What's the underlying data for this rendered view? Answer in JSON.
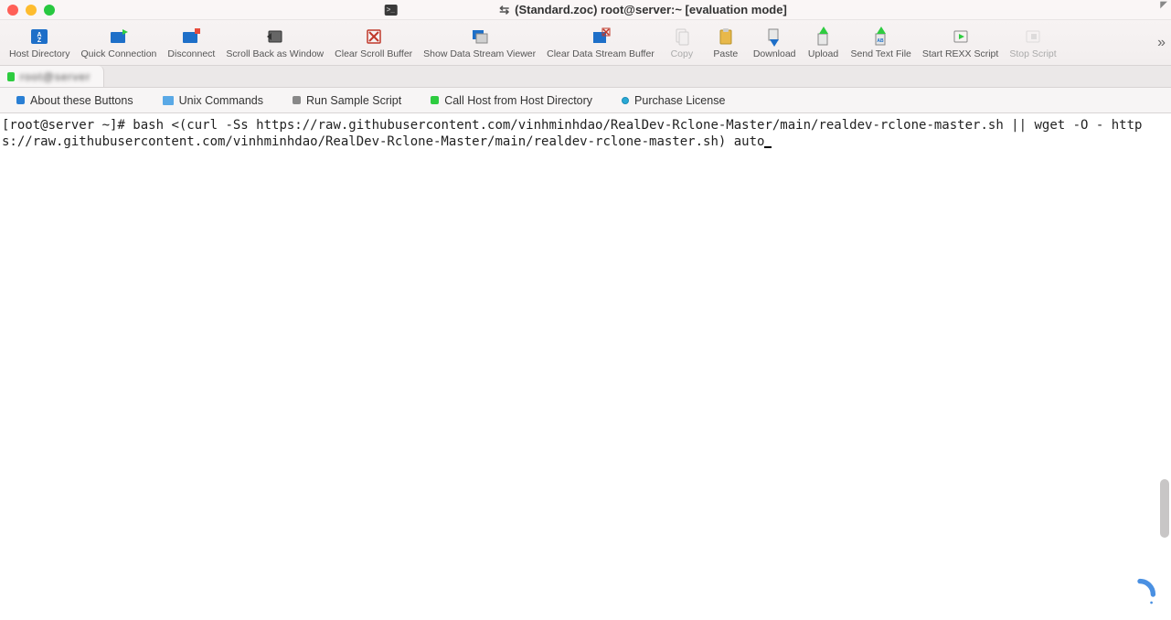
{
  "window": {
    "title": "(Standard.zoc) root@server:~ [evaluation mode]"
  },
  "toolbar": [
    {
      "id": "host-directory",
      "label": "Host Directory",
      "enabled": true
    },
    {
      "id": "quick-connection",
      "label": "Quick Connection",
      "enabled": true
    },
    {
      "id": "disconnect",
      "label": "Disconnect",
      "enabled": true
    },
    {
      "id": "scroll-back-window",
      "label": "Scroll Back as Window",
      "enabled": true
    },
    {
      "id": "clear-scroll-buffer",
      "label": "Clear Scroll Buffer",
      "enabled": true
    },
    {
      "id": "show-data-stream",
      "label": "Show Data Stream Viewer",
      "enabled": true
    },
    {
      "id": "clear-data-stream",
      "label": "Clear Data Stream Buffer",
      "enabled": true
    },
    {
      "id": "copy",
      "label": "Copy",
      "enabled": false
    },
    {
      "id": "paste",
      "label": "Paste",
      "enabled": true
    },
    {
      "id": "download",
      "label": "Download",
      "enabled": true
    },
    {
      "id": "upload",
      "label": "Upload",
      "enabled": true
    },
    {
      "id": "send-text-file",
      "label": "Send Text File",
      "enabled": true
    },
    {
      "id": "start-rexx",
      "label": "Start REXX Script",
      "enabled": true
    },
    {
      "id": "stop-script",
      "label": "Stop Script",
      "enabled": false
    }
  ],
  "tab": {
    "label": "root@server"
  },
  "quickbar": [
    {
      "id": "about-buttons",
      "label": "About these Buttons",
      "color": "blue"
    },
    {
      "id": "unix-commands",
      "label": "Unix Commands",
      "color": "folder"
    },
    {
      "id": "run-sample",
      "label": "Run Sample Script",
      "color": "gray"
    },
    {
      "id": "call-host",
      "label": "Call Host from Host Directory",
      "color": "green"
    },
    {
      "id": "purchase-license",
      "label": "Purchase License",
      "color": "cyan"
    }
  ],
  "terminal": {
    "prompt": "[root@server ~]# ",
    "command": "bash <(curl -Ss https://raw.githubusercontent.com/vinhminhdao/RealDev-Rclone-Master/main/realdev-rclone-master.sh || wget -O - https://raw.githubusercontent.com/vinhminhdao/RealDev-Rclone-Master/main/realdev-rclone-master.sh) auto"
  }
}
